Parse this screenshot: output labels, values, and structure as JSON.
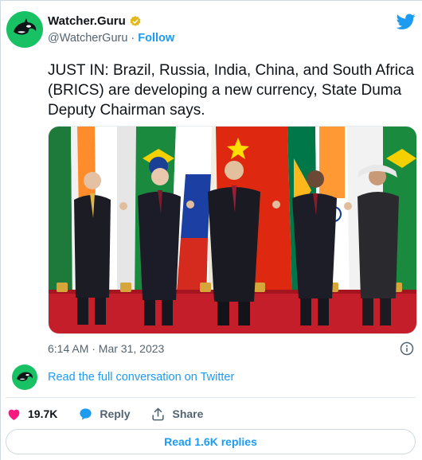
{
  "author": {
    "display_name": "Watcher.Guru",
    "handle": "@WatcherGuru",
    "separator": "·",
    "follow_label": "Follow",
    "avatar_icon": "orca-logo-icon",
    "verified_icon": "verified-badge-icon"
  },
  "tweet": {
    "text": "JUST IN: Brazil, Russia, India, China, and South Africa (BRICS) are developing a new currency, State Duma Deputy Chairman says.",
    "timestamp": "6:14 AM · Mar 31, 2023"
  },
  "conversation": {
    "link_label": "Read the full conversation on Twitter"
  },
  "actions": {
    "likes_count": "19.7K",
    "reply_label": "Reply",
    "share_label": "Share"
  },
  "replies_button": {
    "label": "Read 1.6K replies"
  },
  "colors": {
    "brand_blue": "#1d9bf0",
    "like_pink": "#f91880",
    "avatar_green": "#17c164",
    "muted_text": "#536471"
  }
}
